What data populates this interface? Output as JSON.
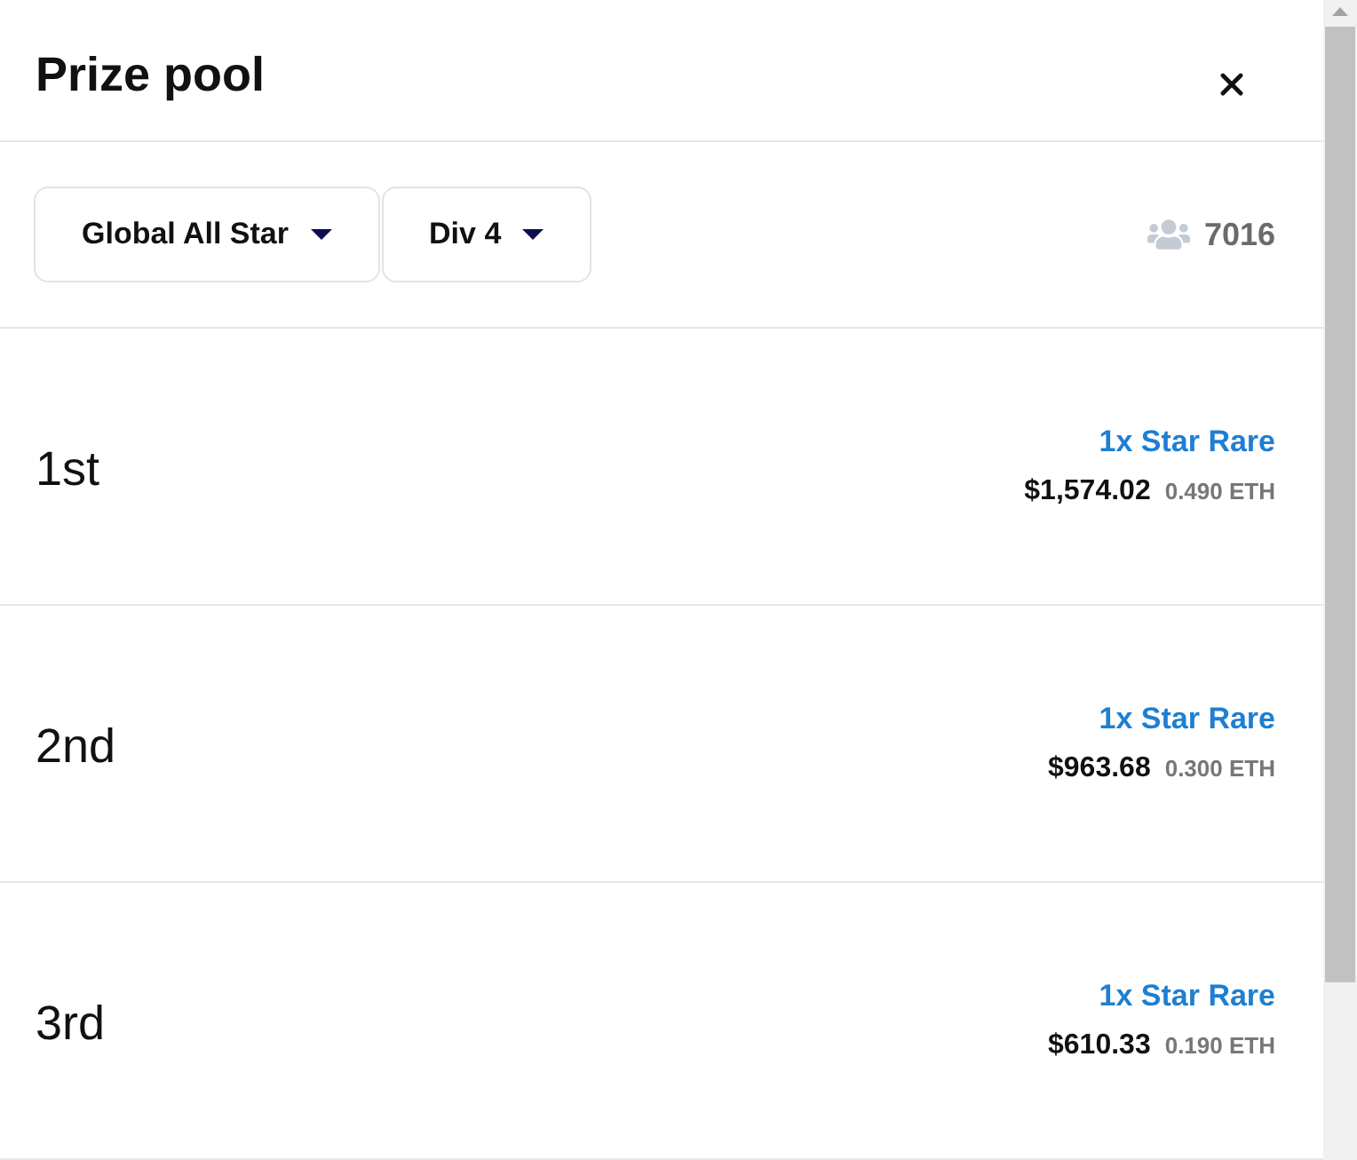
{
  "dialog": {
    "title": "Prize pool"
  },
  "filters": [
    {
      "label": "Global All Star"
    },
    {
      "label": "Div 4"
    }
  ],
  "participants": {
    "count": "7016"
  },
  "prizes": [
    {
      "place": "1st",
      "reward": "1x Star Rare",
      "usd": "$1,574.02",
      "eth": "0.490 ETH"
    },
    {
      "place": "2nd",
      "reward": "1x Star Rare",
      "usd": "$963.68",
      "eth": "0.300 ETH"
    },
    {
      "place": "3rd",
      "reward": "1x Star Rare",
      "usd": "$610.33",
      "eth": "0.190 ETH"
    }
  ]
}
